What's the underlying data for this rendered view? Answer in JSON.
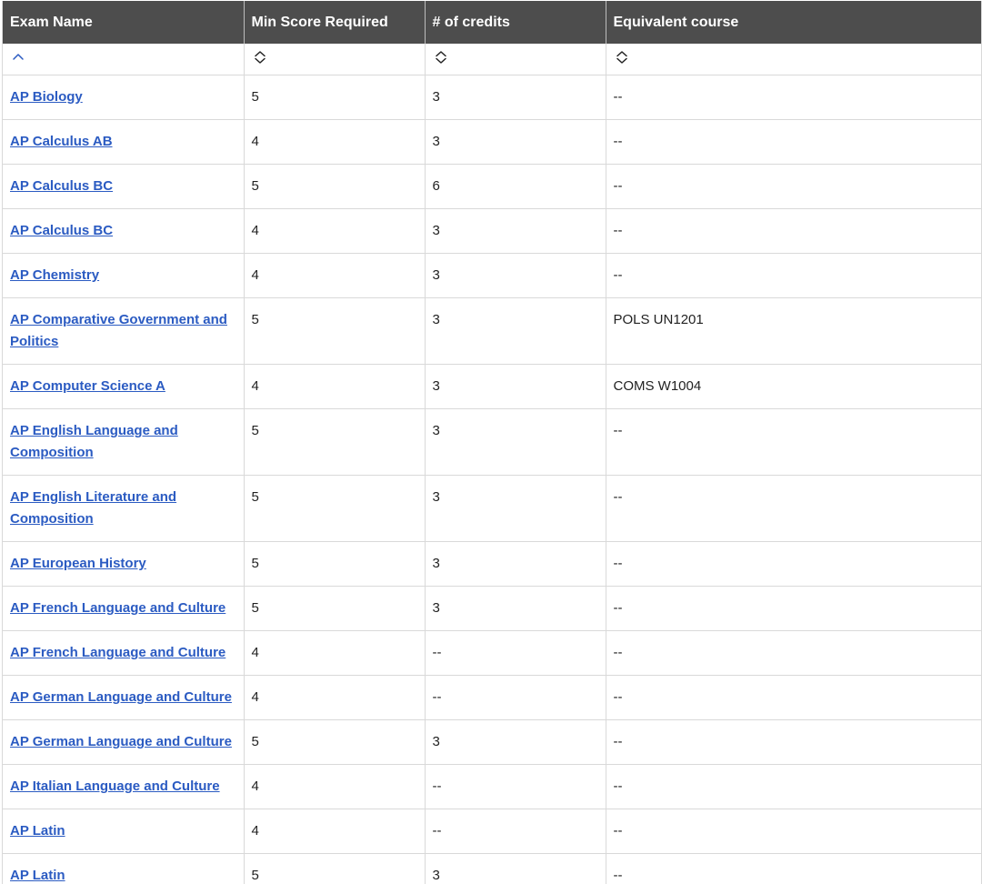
{
  "table": {
    "headers": [
      "Exam Name",
      "Min Score Required",
      "# of credits",
      "Equivalent course"
    ],
    "sort_icons": [
      "chevron-up-icon",
      "sort-updown-icon",
      "sort-updown-icon",
      "sort-updown-icon"
    ],
    "colors": {
      "header_bg": "#4d4d4d",
      "link": "#2b5bc2",
      "border": "#d9d9d9"
    },
    "rows": [
      {
        "exam": "AP Biology",
        "score": "5",
        "credits": "3",
        "course": "--"
      },
      {
        "exam": "AP Calculus AB",
        "score": "4",
        "credits": "3",
        "course": "--"
      },
      {
        "exam": "AP Calculus BC",
        "score": "5",
        "credits": "6",
        "course": "--"
      },
      {
        "exam": "AP Calculus BC",
        "score": "4",
        "credits": "3",
        "course": "--"
      },
      {
        "exam": "AP Chemistry",
        "score": "4",
        "credits": "3",
        "course": "--"
      },
      {
        "exam": "AP Comparative Government and Politics",
        "score": "5",
        "credits": "3",
        "course": "POLS UN1201"
      },
      {
        "exam": "AP Computer Science A",
        "score": "4",
        "credits": "3",
        "course": "COMS W1004"
      },
      {
        "exam": "AP English Language and Composition",
        "score": "5",
        "credits": "3",
        "course": "--"
      },
      {
        "exam": "AP English Literature and Composition",
        "score": "5",
        "credits": "3",
        "course": "--"
      },
      {
        "exam": "AP European History",
        "score": "5",
        "credits": "3",
        "course": "--"
      },
      {
        "exam": "AP French Language and Culture",
        "score": "5",
        "credits": "3",
        "course": "--"
      },
      {
        "exam": "AP French Language and Culture",
        "score": "4",
        "credits": "--",
        "course": "--"
      },
      {
        "exam": "AP German Language and Culture",
        "score": "4",
        "credits": "--",
        "course": "--"
      },
      {
        "exam": "AP German Language and Culture",
        "score": "5",
        "credits": "3",
        "course": "--"
      },
      {
        "exam": "AP Italian Language and Culture",
        "score": "4",
        "credits": "--",
        "course": "--"
      },
      {
        "exam": "AP Latin",
        "score": "4",
        "credits": "--",
        "course": "--"
      },
      {
        "exam": "AP Latin",
        "score": "5",
        "credits": "3",
        "course": "--"
      }
    ]
  }
}
